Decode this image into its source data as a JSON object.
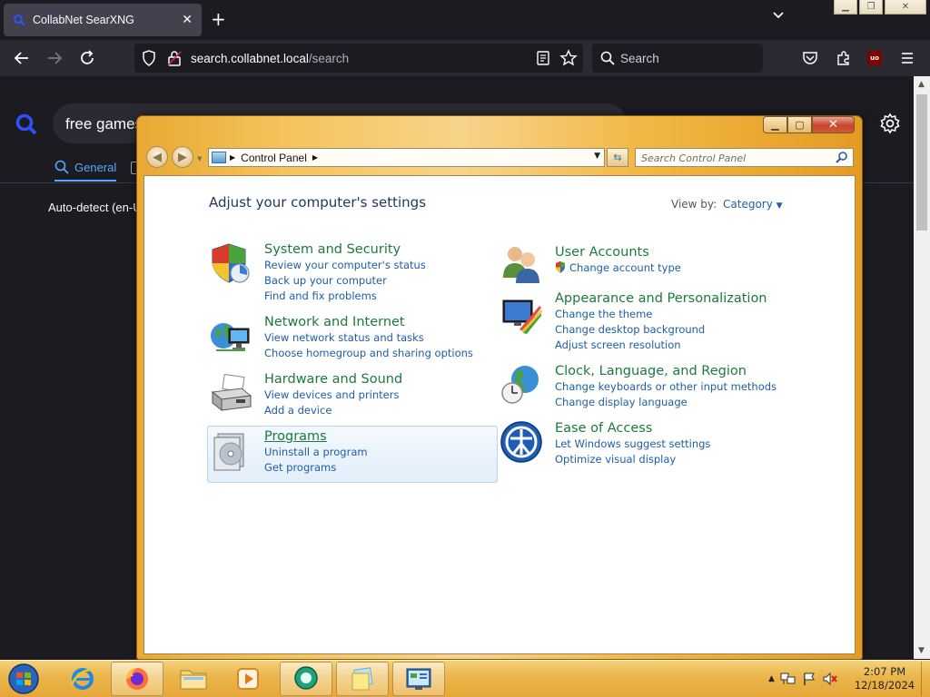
{
  "browser": {
    "tab": {
      "title": "CollabNet SearXNG"
    },
    "url": {
      "host": "search.collabnet.local",
      "path": "/search"
    },
    "search_placeholder": "Search"
  },
  "searx": {
    "query": "free games",
    "tab_general": "General",
    "autodetect": "Auto-detect (en-U"
  },
  "control_panel": {
    "address": "Control Panel",
    "search_placeholder": "Search Control Panel",
    "heading": "Adjust your computer's settings",
    "view_by_label": "View by:",
    "view_by_value": "Category",
    "left": [
      {
        "title": "System and Security",
        "icon": "shield-icon",
        "links": [
          "Review your computer's status",
          "Back up your computer",
          "Find and fix problems"
        ]
      },
      {
        "title": "Network and Internet",
        "icon": "network-globe-icon",
        "links": [
          "View network status and tasks",
          "Choose homegroup and sharing options"
        ]
      },
      {
        "title": "Hardware and Sound",
        "icon": "printer-icon",
        "links": [
          "View devices and printers",
          "Add a device"
        ]
      },
      {
        "title": "Programs",
        "icon": "programs-disc-icon",
        "links": [
          "Uninstall a program",
          "Get programs"
        ]
      }
    ],
    "right": [
      {
        "title": "User Accounts",
        "icon": "users-icon",
        "links": [
          "Change account type"
        ]
      },
      {
        "title": "Appearance and Personalization",
        "icon": "monitor-paint-icon",
        "links": [
          "Change the theme",
          "Change desktop background",
          "Adjust screen resolution"
        ]
      },
      {
        "title": "Clock, Language, and Region",
        "icon": "globe-clock-icon",
        "links": [
          "Change keyboards or other input methods",
          "Change display language"
        ]
      },
      {
        "title": "Ease of Access",
        "icon": "ease-of-access-icon",
        "links": [
          "Let Windows suggest settings",
          "Optimize visual display"
        ]
      }
    ]
  },
  "taskbar": {
    "time": "2:07 PM",
    "date": "12/18/2024",
    "pinned": [
      "internet-explorer-icon",
      "firefox-icon",
      "file-explorer-icon",
      "media-player-icon",
      "chat-app-icon",
      "sticky-notes-icon",
      "control-panel-icon"
    ]
  },
  "colors": {
    "firefox_dark": "#1c1b22",
    "firefox_bar": "#2b2a33",
    "searx_accent": "#58a6ff",
    "cp_title_green": "#1b7a3e",
    "cp_link_blue": "#1e5ea6",
    "window_frame": "#f2b744"
  }
}
